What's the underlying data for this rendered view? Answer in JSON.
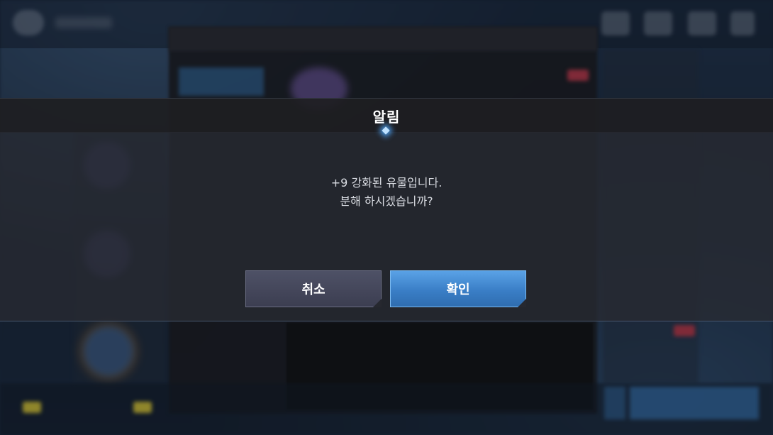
{
  "dialog": {
    "title": "알림",
    "message_line1": "+9 강화된 유물입니다.",
    "message_line2": "분해 하시겠습니까?",
    "cancel_label": "취소",
    "confirm_label": "확인"
  },
  "colors": {
    "confirm_button": "#3a7ec6",
    "cancel_button": "#45475a",
    "title_accent": "#bfe2ff"
  }
}
